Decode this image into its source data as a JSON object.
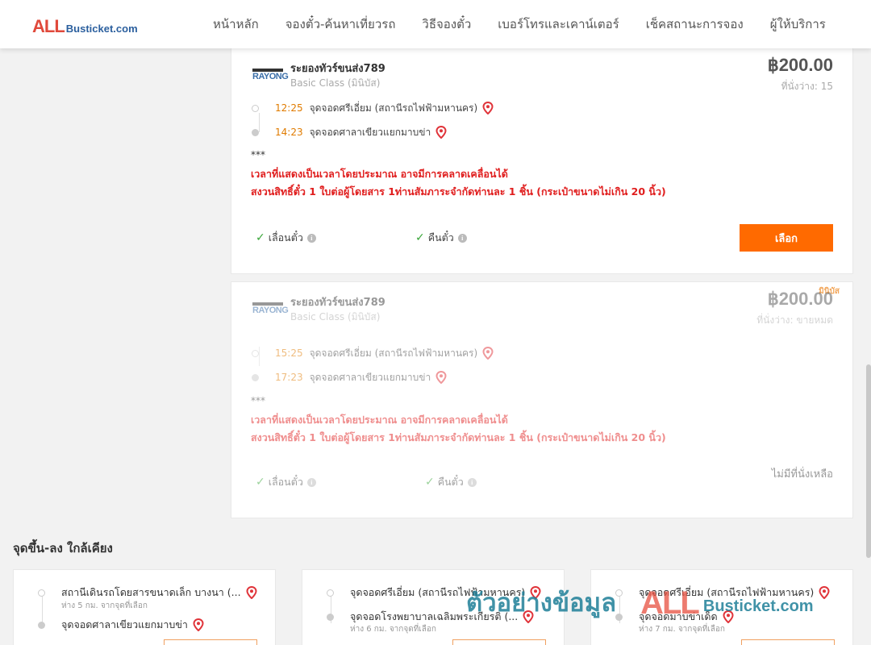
{
  "header": {
    "logo_all": "ALL",
    "logo_rest": "Busticket.com",
    "nav": [
      "หน้าหลัก",
      "จองตั๋ว-ค้นหาเที่ยวรถ",
      "วิธีจองตั๋ว",
      "เบอร์โทรและเคาน์เตอร์",
      "เช็คสถานะการจอง",
      "ผู้ให้บริการ"
    ]
  },
  "trips": [
    {
      "operator": "ระยองทัวร์ขนส่ง789",
      "operator_logo": "RAYONG",
      "class": "Basic Class (มินิบัส)",
      "price": "฿200.00",
      "seats": "ที่นั่งว่าง: 15",
      "depart_time": "12:25",
      "depart_place": "จุดจอดศรีเอี่ยม (สถานีรถไฟฟ้ามหานคร)",
      "arrive_time": "14:23",
      "arrive_place": "จุดจอดศาลาเขียวแยกมาบข่า",
      "stars": "***",
      "note1": "เวลาที่แสดงเป็นเวลาโดยประมาณ อาจมีการคลาดเคลื่อนได้",
      "note2": "สงวนสิทธิ์ตั๋ว 1 ใบต่อผู้โดยสาร 1ท่านสัมภาระจำกัดท่านละ 1 ชิ้น (กระเป๋าขนาดไม่เกิน 20 นิ้ว)",
      "opt_change": "เลื่อนตั๋ว",
      "opt_refund": "คืนตั๋ว",
      "select_label": "เลือก"
    },
    {
      "badge": "มินิบัส",
      "operator": "ระยองทัวร์ขนส่ง789",
      "operator_logo": "RAYONG",
      "class": "Basic Class (มินิบัส)",
      "price": "฿200.00",
      "seats": "ที่นั่งว่าง: ขายหมด",
      "depart_time": "15:25",
      "depart_place": "จุดจอดศรีเอี่ยม (สถานีรถไฟฟ้ามหานคร)",
      "arrive_time": "17:23",
      "arrive_place": "จุดจอดศาลาเขียวแยกมาบข่า",
      "stars": "***",
      "note1": "เวลาที่แสดงเป็นเวลาโดยประมาณ อาจมีการคลาดเคลื่อนได้",
      "note2": "สงวนสิทธิ์ตั๋ว 1 ใบต่อผู้โดยสาร 1ท่านสัมภาระจำกัดท่านละ 1 ชิ้น (กระเป๋าขนาดไม่เกิน 20 นิ้ว)",
      "opt_change": "เลื่อนตั๋ว",
      "opt_refund": "คืนตั๋ว",
      "soldout": "ไม่มีที่นั่งเหลือ"
    }
  ],
  "nearby": {
    "title": "จุดขึ้น-ลง ใกล้เคียง",
    "cards": [
      {
        "from": "สถานีเดินรถโดยสารขนาดเล็ก บางนา (...",
        "from_dist": "ห่าง 5 กม. จากจุดที่เลือก",
        "to": "จุดจอดศาลาเขียวแยกมาบข่า",
        "to_dist": ""
      },
      {
        "from": "จุดจอดศรีเอี่ยม (สถานีรถไฟฟ้ามหานคร)",
        "from_dist": "",
        "to": "จุดจอดโรงพยาบาลเฉลิมพระเกียรติ (...",
        "to_dist": "ห่าง 6 กม. จากจุดที่เลือก"
      },
      {
        "from": "จุดจอดศรีเอี่ยม (สถานีรถไฟฟ้ามหานคร)",
        "from_dist": "",
        "to": "จุดจอดมาบข่าเด็ด",
        "to_dist": "ห่าง 7 กม. จากจุดที่เลือก"
      }
    ]
  },
  "watermark": {
    "thai": "ตัวอย่างข้อมูล",
    "all": "ALL",
    "rest": "Busticket.com"
  },
  "colors": {
    "accent": "#ff6a00",
    "note": "#e01e1e",
    "time": "#e07b00",
    "check": "#3aa63a",
    "pin": "#e0343a"
  }
}
